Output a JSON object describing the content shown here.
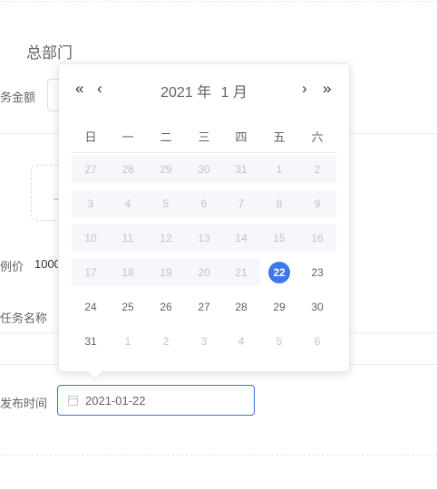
{
  "form": {
    "dept_name": "总部门",
    "amount_label": "务金额",
    "upload_text": "上",
    "ratio_label": "例价",
    "ratio_value": "1000",
    "task_name_label": "任务名称",
    "publish_time_label": "发布时间",
    "publish_time_value": "2021-01-22",
    "publish_time_icon": "calendar-icon"
  },
  "datepicker": {
    "prev_year": "«",
    "prev_month": "‹",
    "next_month": "›",
    "next_year": "»",
    "year_label": "2021 年",
    "month_label": "1 月",
    "weekdays": [
      "日",
      "一",
      "二",
      "三",
      "四",
      "五",
      "六"
    ],
    "rows": [
      [
        "27",
        "28",
        "29",
        "30",
        "31",
        "1",
        "2"
      ],
      [
        "3",
        "4",
        "5",
        "6",
        "7",
        "8",
        "9"
      ],
      [
        "10",
        "11",
        "12",
        "13",
        "14",
        "15",
        "16"
      ],
      [
        "17",
        "18",
        "19",
        "20",
        "21",
        "22",
        "23"
      ],
      [
        "24",
        "25",
        "26",
        "27",
        "28",
        "29",
        "30"
      ],
      [
        "31",
        "1",
        "2",
        "3",
        "4",
        "5",
        "6"
      ]
    ],
    "selected": "22",
    "accent_color": "#3d78e8"
  }
}
